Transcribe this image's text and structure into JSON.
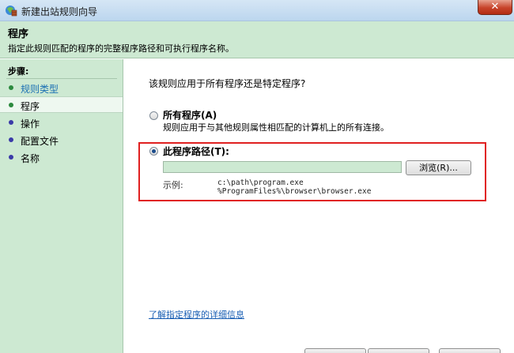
{
  "window": {
    "title": "新建出站规则向导",
    "close_glyph": "✕"
  },
  "header": {
    "title": "程序",
    "subtitle": "指定此规则匹配的程序的完整程序路径和可执行程序名称。"
  },
  "sidebar": {
    "steps_label": "步骤:",
    "items": [
      {
        "label": "规则类型",
        "state": "done"
      },
      {
        "label": "程序",
        "state": "current"
      },
      {
        "label": "操作",
        "state": "pending"
      },
      {
        "label": "配置文件",
        "state": "pending"
      },
      {
        "label": "名称",
        "state": "pending"
      }
    ]
  },
  "main": {
    "question": "该规则应用于所有程序还是特定程序?",
    "option_all": {
      "label": "所有程序(A)",
      "description": "规则应用于与其他规则属性相匹配的计算机上的所有连接。",
      "selected": false
    },
    "option_path": {
      "label": "此程序路径(T):",
      "selected": true,
      "input_value": "",
      "browse_label": "浏览(R)...",
      "example_label": "示例:",
      "example_lines": [
        "c:\\path\\program.exe",
        "%ProgramFiles%\\browser\\browser.exe"
      ]
    },
    "learn_more_link": "了解指定程序的详细信息"
  },
  "colors": {
    "header_bg": "#cde9d2",
    "highlight_border": "#e02020",
    "link": "#1a5fb4"
  }
}
